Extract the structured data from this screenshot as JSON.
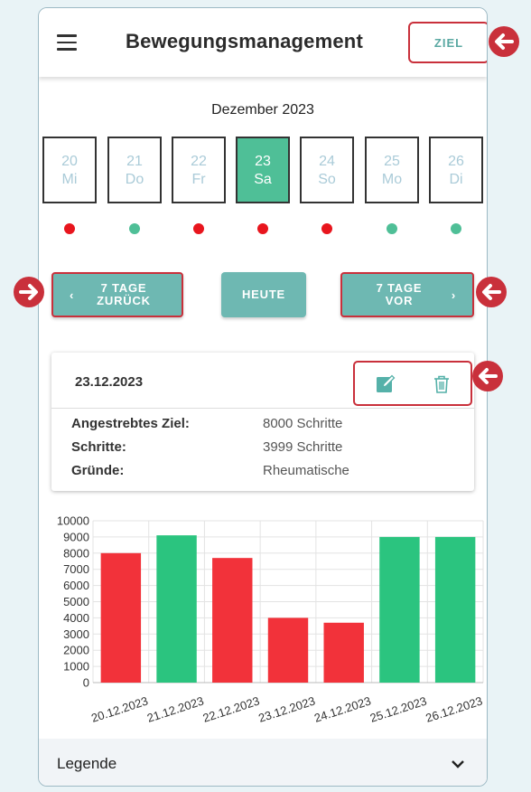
{
  "header": {
    "title": "Bewegungsmanagement",
    "goal_button": "ZIEL"
  },
  "calendar": {
    "month": "Dezember 2023",
    "days": [
      {
        "num": "20",
        "weekday": "Mi",
        "selected": false,
        "status": "red"
      },
      {
        "num": "21",
        "weekday": "Do",
        "selected": false,
        "status": "green"
      },
      {
        "num": "22",
        "weekday": "Fr",
        "selected": false,
        "status": "red"
      },
      {
        "num": "23",
        "weekday": "Sa",
        "selected": true,
        "status": "red"
      },
      {
        "num": "24",
        "weekday": "So",
        "selected": false,
        "status": "red"
      },
      {
        "num": "25",
        "weekday": "Mo",
        "selected": false,
        "status": "green"
      },
      {
        "num": "26",
        "weekday": "Di",
        "selected": false,
        "status": "green"
      }
    ]
  },
  "nav": {
    "back_line1": "7 TAGE",
    "back_line2": "ZURÜCK",
    "today": "HEUTE",
    "forward_line1": "7 TAGE",
    "forward_line2": "VOR"
  },
  "card": {
    "date": "23.12.2023",
    "rows": [
      {
        "label": "Angestrebtes Ziel:",
        "value": "8000 Schritte"
      },
      {
        "label": "Schritte:",
        "value": "3999 Schritte"
      },
      {
        "label": "Gründe:",
        "value": "Rheumatische"
      }
    ]
  },
  "chart_data": {
    "type": "bar",
    "categories": [
      "20.12.2023",
      "21.12.2023",
      "22.12.2023",
      "23.12.2023",
      "24.12.2023",
      "25.12.2023",
      "26.12.2023"
    ],
    "values": [
      8000,
      9100,
      7700,
      4000,
      3700,
      9000,
      9000
    ],
    "colors": [
      "#f2323a",
      "#2bc47f",
      "#f2323a",
      "#f2323a",
      "#f2323a",
      "#2bc47f",
      "#2bc47f"
    ],
    "ylim": [
      0,
      10000
    ],
    "yticks": [
      "0",
      "1000",
      "2000",
      "3000",
      "4000",
      "5000",
      "6000",
      "7000",
      "8000",
      "9000",
      "10000"
    ],
    "grid": true
  },
  "legend": {
    "label": "Legende"
  },
  "colors": {
    "accent": "#6eb8b2",
    "selected": "#4fbf97",
    "good": "#2bc47f",
    "bad": "#f2323a",
    "highlight": "#c9303b"
  }
}
